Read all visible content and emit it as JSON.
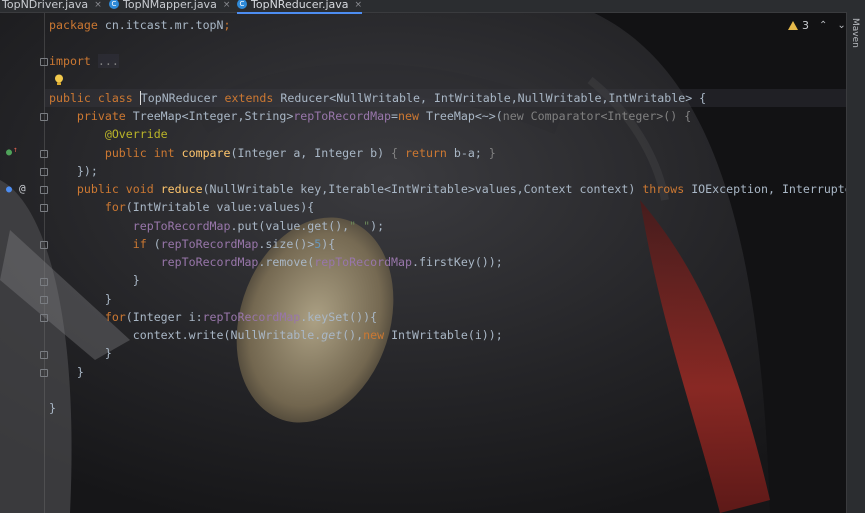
{
  "tabs": [
    {
      "label": "TopNDriver.java",
      "active": false
    },
    {
      "label": "TopNMapper.java",
      "active": false
    },
    {
      "label": "TopNReducer.java",
      "active": true
    }
  ],
  "tab_close_glyph": "×",
  "tab_icon_letter": "C",
  "right_panel": {
    "label": "Maven"
  },
  "inspections": {
    "warning_count": "3",
    "icon": "warning-triangle-icon"
  },
  "code": {
    "line1": [
      "package ",
      "cn.itcast.mr.topN",
      ";"
    ],
    "line2": [
      "import ",
      "..."
    ],
    "line3": [
      "public class ",
      "TopNReducer ",
      "extends ",
      "Reducer<NullWritable, IntWritable,NullWritable,IntWritable> {"
    ],
    "line4": [
      "    private ",
      "TreeMap<Integer,String>",
      "repToRecordMap",
      "=",
      "new ",
      "TreeMap<~>(",
      "new Comparator<Integer>() {"
    ],
    "line5": [
      "        @Override"
    ],
    "line6": [
      "        public ",
      "int ",
      "compare",
      "(Integer a, Integer b) ",
      "{ ",
      "return ",
      "b-a; ",
      "}"
    ],
    "line7": [
      "    });"
    ],
    "line8": [
      "    public ",
      "void ",
      "reduce",
      "(NullWritable key,Iterable<IntWritable>values,Context context) ",
      "throws ",
      "IOException, InterruptedExce"
    ],
    "line9": [
      "        for",
      "(IntWritable value:values){"
    ],
    "line10": [
      "            ",
      "repToRecordMap",
      ".put(value.get(),",
      "\" \"",
      ");"
    ],
    "line11": [
      "            if ",
      "(",
      "repToRecordMap",
      ".size()>",
      "5",
      "){"
    ],
    "line12": [
      "                ",
      "repToRecordMap",
      ".remove(",
      "repToRecordMap",
      ".firstKey());"
    ],
    "line13": [
      "            }"
    ],
    "line14": [
      "        }"
    ],
    "line15": [
      "        for",
      "(Integer i:",
      "repToRecordMap",
      ".keySet()){"
    ],
    "line16": [
      "            context.write(NullWritable.",
      "get",
      "(),",
      "new ",
      "IntWritable(i));"
    ],
    "line17": [
      "        }"
    ],
    "line18": [
      "    }"
    ],
    "line19": [
      "}"
    ]
  },
  "colors": {
    "keyword": "#cc7832",
    "plain": "#a9b7c6",
    "field": "#9876aa",
    "method": "#ffc66d",
    "number": "#6897bb",
    "string": "#6a8759",
    "annotation": "#bbb529",
    "accent": "#4d8df1"
  }
}
